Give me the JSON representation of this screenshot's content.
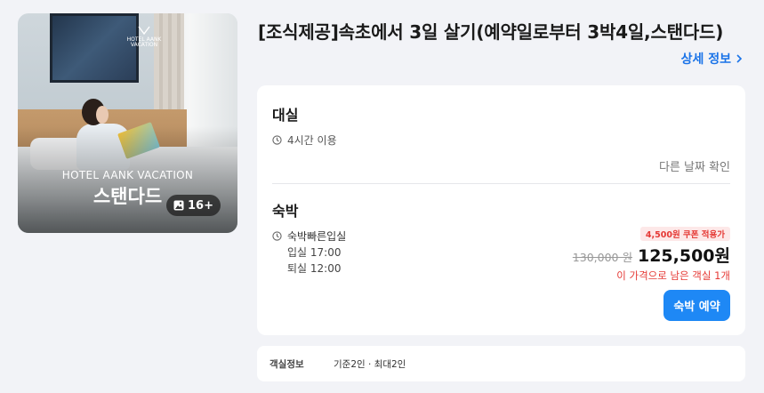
{
  "room_image": {
    "hotel_name": "HOTEL AANK VACATION",
    "room_name": "스탠다드",
    "photo_count": "16+",
    "logo_lines": [
      "HOTEL AANK",
      "VACATION"
    ]
  },
  "product": {
    "title": "[조식제공]속초에서 3일 살기(예약일로부터 3박4일,스탠다드)",
    "detail_link": "상세 정보"
  },
  "day_use": {
    "title": "대실",
    "duration": "4시간 이용",
    "other_dates": "다른 날짜 확인"
  },
  "stay": {
    "title": "숙박",
    "checkin_type": "숙박빠른입실",
    "checkin": "입실 17:00",
    "checkout": "퇴실 12:00",
    "coupon_badge": "4,500원 쿠폰 적용가",
    "original_price": "130,000 원",
    "sale_price": "125,500원",
    "rooms_left": "이 가격으로 남은 객실 1개",
    "book_button": "숙박 예약"
  },
  "room_info": {
    "label": "객실정보",
    "value": "기준2인 · 최대2인"
  },
  "colors": {
    "accent": "#1e88f5",
    "link": "#1a73e8",
    "alert": "#e53935",
    "background": "#f2f3f7"
  }
}
